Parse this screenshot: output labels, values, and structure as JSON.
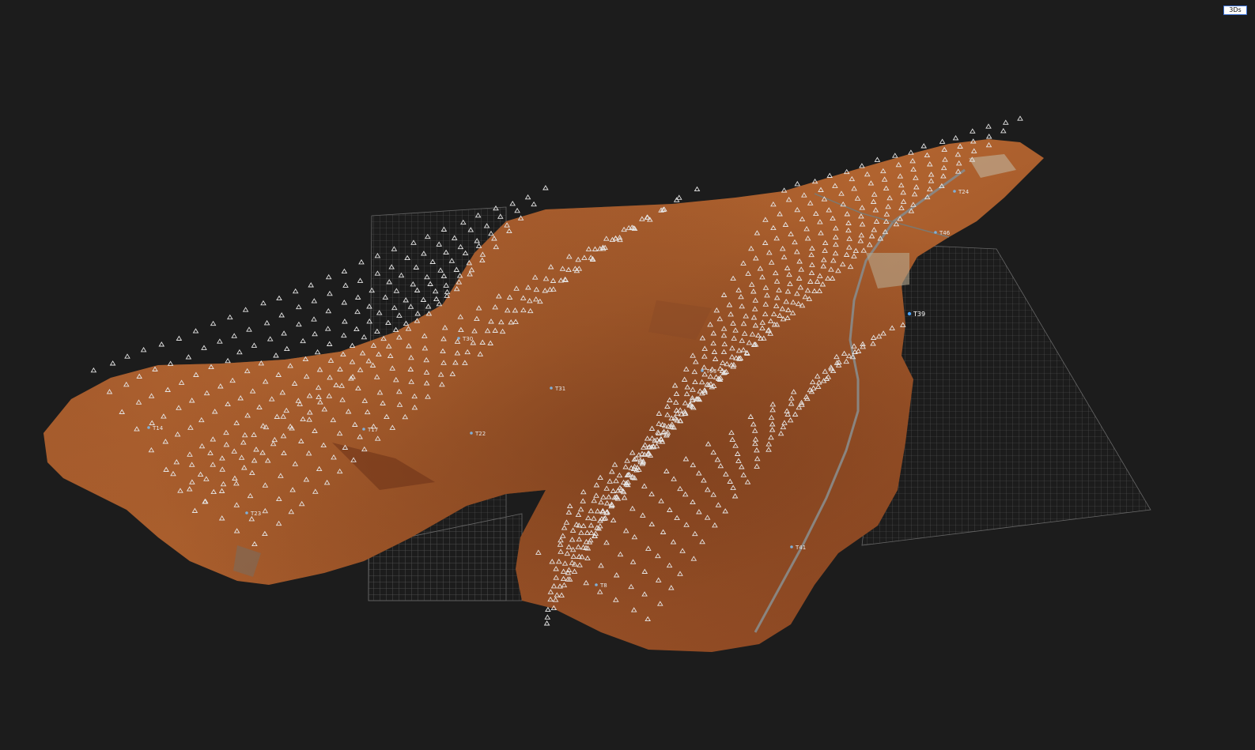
{
  "toolbar": {
    "mode_button_label": "3Ds"
  },
  "scene": {
    "background_color": "#1c1c1c",
    "grid_color": "#5a5a5a",
    "terrain_colors": [
      "#a85a2c",
      "#8f4a24",
      "#b66834",
      "#7a3e1d"
    ],
    "camera_marker_color": "#e6e6e6",
    "ground_control_points": [
      {
        "id": "T24",
        "highlighted": false
      },
      {
        "id": "T46",
        "highlighted": false
      },
      {
        "id": "T39",
        "highlighted": true
      },
      {
        "id": "T30",
        "highlighted": false
      },
      {
        "id": "T31",
        "highlighted": false
      },
      {
        "id": "T14",
        "highlighted": false
      },
      {
        "id": "T17",
        "highlighted": false
      },
      {
        "id": "T22",
        "highlighted": false
      },
      {
        "id": "T23",
        "highlighted": false
      },
      {
        "id": "T8",
        "highlighted": false
      },
      {
        "id": "T53",
        "highlighted": false
      },
      {
        "id": "T41",
        "highlighted": false
      }
    ]
  }
}
